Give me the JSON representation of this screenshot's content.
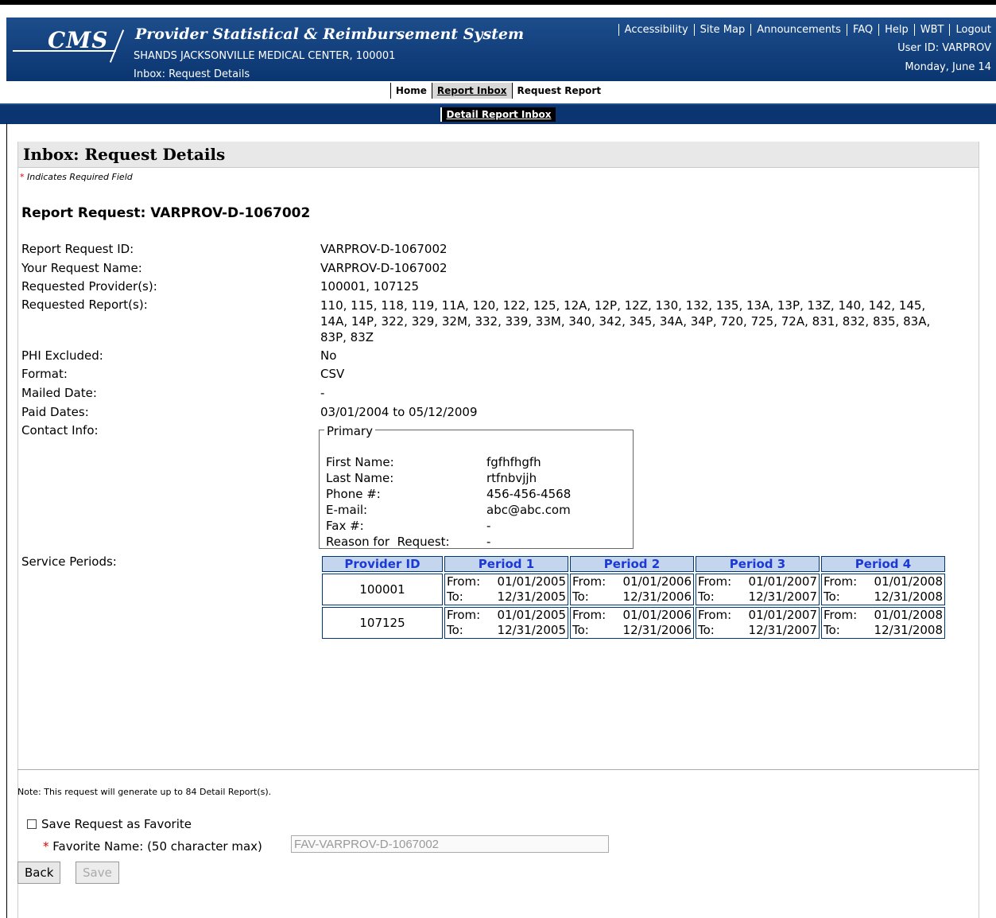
{
  "header": {
    "logo_text": "CMS",
    "title": "Provider Statistical & Reimbursement System",
    "provider": "SHANDS JACKSONVILLE MEDICAL CENTER, 100001",
    "breadcrumb": "Inbox: Request Details",
    "links": [
      "Accessibility",
      "Site Map",
      "Announcements",
      "FAQ",
      "Help",
      "WBT",
      "Logout"
    ],
    "user_id": "User ID: VARPROV",
    "date": "Monday, June 14"
  },
  "nav": {
    "home": "Home",
    "report_inbox": "Report Inbox",
    "request_report": "Request Report",
    "sub_tab": "Detail Report Inbox"
  },
  "page": {
    "title": "Inbox: Request Details",
    "required_note": "Indicates Required Field",
    "request_title": "Report Request: VARPROV-D-1067002"
  },
  "fields": {
    "report_request_id": {
      "label": "Report Request ID:",
      "value": "VARPROV-D-1067002"
    },
    "request_name": {
      "label": "Your Request Name:",
      "value": "VARPROV-D-1067002"
    },
    "providers": {
      "label": "Requested Provider(s):",
      "value": "100001, 107125"
    },
    "reports": {
      "label": "Requested Report(s):",
      "value": "110, 115, 118, 119, 11A, 120, 122, 125, 12A, 12P, 12Z, 130, 132, 135, 13A, 13P, 13Z, 140, 142, 145, 14A, 14P, 322, 329, 32M, 332, 339, 33M, 340, 342, 345, 34A, 34P, 720, 725, 72A, 831, 832, 835, 83A, 83P, 83Z"
    },
    "phi": {
      "label": "PHI Excluded:",
      "value": "No"
    },
    "format": {
      "label": "Format:",
      "value": "CSV"
    },
    "mailed": {
      "label": "Mailed Date:",
      "value": "-"
    },
    "paid": {
      "label": "Paid Dates:",
      "value": "03/01/2004 to 05/12/2009"
    },
    "contact": {
      "label": "Contact Info:"
    },
    "service": {
      "label": "Service Periods:"
    }
  },
  "contact": {
    "legend": "Primary",
    "rows": [
      {
        "label": "First Name:",
        "value": "fgfhfhgfh"
      },
      {
        "label": "Last Name:",
        "value": "rtfnbvjjh"
      },
      {
        "label": "Phone #:",
        "value": "456-456-4568"
      },
      {
        "label": "E-mail:",
        "value": "abc@abc.com"
      },
      {
        "label": "Fax #:",
        "value": "-"
      },
      {
        "label": "Reason for  Request:",
        "value": "-"
      }
    ]
  },
  "service_periods": {
    "headers": [
      "Provider ID",
      "Period 1",
      "Period 2",
      "Period 3",
      "Period 4"
    ],
    "from_label": "From:",
    "to_label": "To:",
    "rows": [
      {
        "provider": "100001",
        "periods": [
          [
            "01/01/2005",
            "12/31/2005"
          ],
          [
            "01/01/2006",
            "12/31/2006"
          ],
          [
            "01/01/2007",
            "12/31/2007"
          ],
          [
            "01/01/2008",
            "12/31/2008"
          ]
        ]
      },
      {
        "provider": "107125",
        "periods": [
          [
            "01/01/2005",
            "12/31/2005"
          ],
          [
            "01/01/2006",
            "12/31/2006"
          ],
          [
            "01/01/2007",
            "12/31/2007"
          ],
          [
            "01/01/2008",
            "12/31/2008"
          ]
        ]
      }
    ]
  },
  "footer": {
    "note": "Note: This request will generate up to 84 Detail Report(s).",
    "save_favorite_label": "Save Request as Favorite",
    "favorite_name_label": "Favorite Name: (50 character max)",
    "favorite_name_value": "FAV-VARPROV-D-1067002",
    "back_button": "Back",
    "save_button": "Save"
  }
}
